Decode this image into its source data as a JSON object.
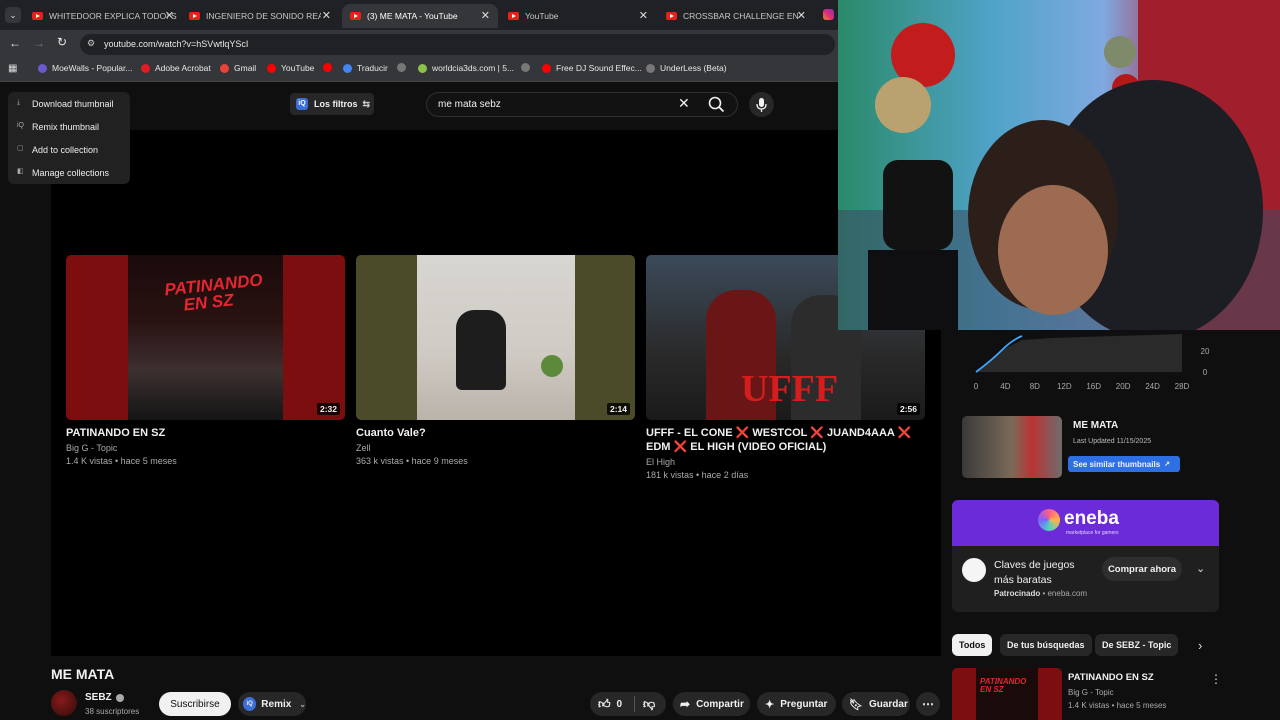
{
  "browser": {
    "tabs": [
      {
        "label": "WHITEDOOR EXPLICA TODO: S",
        "active": false
      },
      {
        "label": "INGENIERO DE SONIDO REACC",
        "active": false
      },
      {
        "label": "(3) ME MATA - YouTube",
        "active": true
      },
      {
        "label": "YouTube",
        "active": false
      },
      {
        "label": "CROSSBAR CHALLENGE EN ESP",
        "active": false
      }
    ],
    "url": "youtube.com/watch?v=hSVwtlqYScI",
    "bookmarks": [
      {
        "label": "MoeWalls - Popular...",
        "color": "#6a5acd"
      },
      {
        "label": "Adobe Acrobat",
        "color": "#e11c24"
      },
      {
        "label": "Gmail",
        "color": "#ea4335"
      },
      {
        "label": "YouTube",
        "color": "#ff0000"
      },
      {
        "label": "Traducir",
        "color": "#4285f4"
      },
      {
        "label": "worldcia3ds.com | 5...",
        "color": "#8bc34a"
      },
      {
        "label": "Free DJ Sound Effec...",
        "color": "#ff0000"
      },
      {
        "label": "UnderLess (Beta)",
        "color": "#777777"
      }
    ]
  },
  "extension_menu": {
    "items": [
      "Download thumbnail",
      "Remix thumbnail",
      "Add to collection",
      "Manage collections"
    ]
  },
  "header": {
    "filters_label": "Los filtros",
    "search_value": "me mata sebz"
  },
  "end_screen": {
    "videos": [
      {
        "title": "PATINANDO EN SZ",
        "channel": "Big G - Topic",
        "meta": "1.4 K vistas • hace 5 meses",
        "duration": "2:32"
      },
      {
        "title": "Cuanto Vale?",
        "channel": "Zell",
        "meta": "363 k vistas • hace 9 meses",
        "duration": "2:14"
      },
      {
        "title": "UFFF - EL CONE ❌ WESTCOL ❌ JUAND4AAA ❌ EDM ❌ EL HIGH (VIDEO OFICIAL)",
        "channel": "El High",
        "meta": "181 k vistas • hace 2 días",
        "duration": "2:56",
        "overlay_text": "UFFF"
      }
    ]
  },
  "video": {
    "title": "ME MATA",
    "channel": "SEBZ",
    "subscribers": "38 suscriptores",
    "subscribe_label": "Suscribirse",
    "remix_label": "Remix",
    "likes": "0",
    "share_label": "Compartir",
    "ask_label": "Preguntar",
    "save_label": "Guardar"
  },
  "sidebar": {
    "chart": {
      "x_ticks": [
        "0",
        "4D",
        "8D",
        "12D",
        "16D",
        "20D",
        "24D",
        "28D"
      ],
      "y_ticks": [
        "20",
        "0"
      ]
    },
    "thumbnail_card": {
      "title": "ME MATA",
      "updated": "Last Updated 11/15/2025",
      "button_label": "See similar thumbnails"
    },
    "ad": {
      "brand": "eneba",
      "tagline": "marketplace for gamers",
      "headline": "Claves de juegos más baratas",
      "sponsor": "Patrocinado",
      "domain": "eneba.com",
      "cta": "Comprar ahora"
    },
    "chips": [
      "Todos",
      "De tus búsquedas",
      "De SEBZ - Topic"
    ],
    "recommended": {
      "title": "PATINANDO EN SZ",
      "channel": "Big G - Topic",
      "meta": "1.4 K vistas • hace 5 meses"
    }
  }
}
